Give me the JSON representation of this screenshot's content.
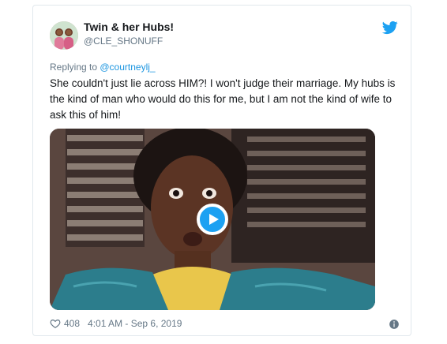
{
  "user": {
    "name": "Twin & her Hubs!",
    "handle": "@CLE_SHONUFF"
  },
  "reply": {
    "prefix": "Replying to ",
    "mention": "@courtneylj_"
  },
  "tweet": {
    "text": "She couldn't just lie across HIM?! I won't judge their marriage. My hubs is the kind of man who would do this for me, but I am not the kind of wife to ask this of him!"
  },
  "media": {
    "kind": "gif",
    "play_icon": "play-icon"
  },
  "footer": {
    "likes": "408",
    "timestamp": "4:01 AM - Sep 6, 2019"
  },
  "icons": {
    "brand": "twitter-bird-icon",
    "like": "heart-icon",
    "info": "info-icon"
  },
  "colors": {
    "twitter_blue": "#1da1f2",
    "mention_blue": "#1b95e0",
    "secondary_text": "#657786",
    "primary_text": "#14171a",
    "border": "#e1e8ed"
  }
}
